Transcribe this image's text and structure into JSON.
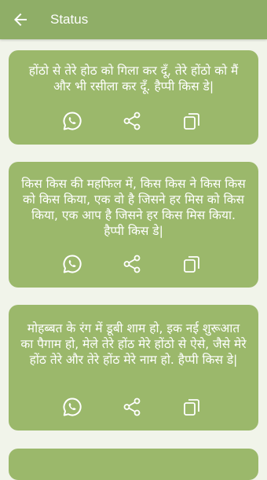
{
  "appbar": {
    "title": "Status"
  },
  "cards": [
    {
      "text": "होंठो से तेरे होठ को गिला कर दूँ, तेरे होंठो को मैं और भी रसीला कर दूँ. हैप्पी किस डे|"
    },
    {
      "text": "किस किस की महफिल में, किस किस ने किस किस को किस किया, एक वो है जिसने हर मिस को किस किया, एक आप है जिसने हर किस मिस किया. हैप्पी किस डे|"
    },
    {
      "text": "मोहब्बत के रंग में डूबी शाम हो, इक नई शुरूआत का पैगाम हो, मेले तेरे होंठ मेरे होंठो से ऐसे, जैसे मेरे होंठ तेरे और तेरे होंठ मेरे नाम हो. हैप्पी किस डे|"
    }
  ],
  "icons": {
    "back": "arrow-left-icon",
    "whatsapp": "whatsapp-icon",
    "share": "share-icon",
    "copy": "copy-icon"
  },
  "colors": {
    "appbar": "#8fae67",
    "card": "#9bb86b",
    "background": "#f1f4ea",
    "text": "#ffffff"
  }
}
